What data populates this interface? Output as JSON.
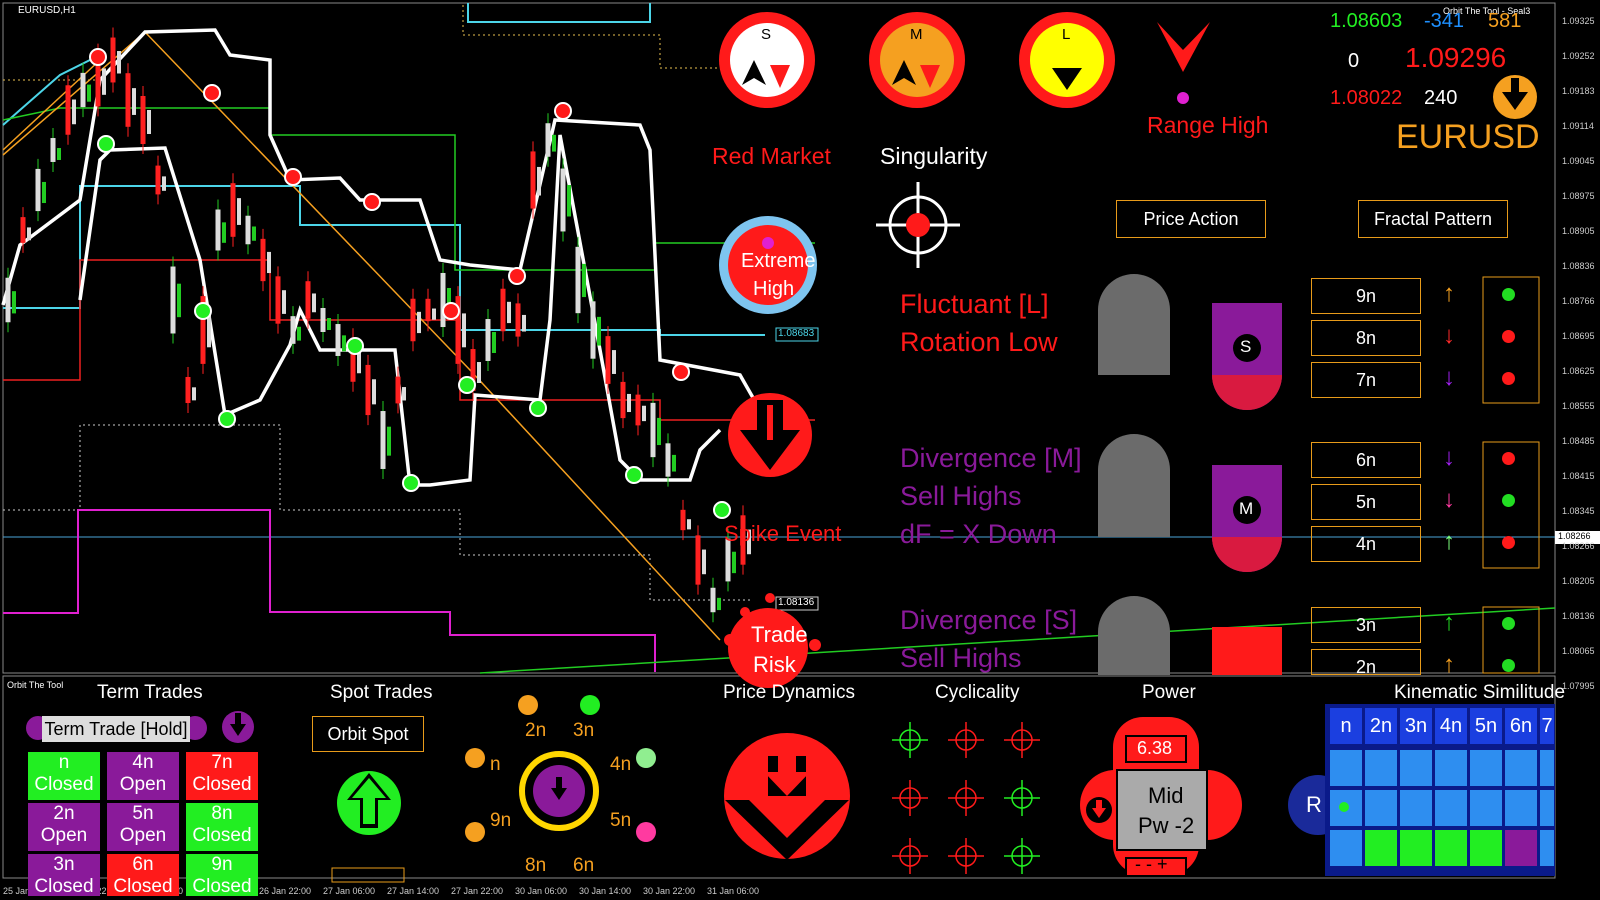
{
  "window": {
    "symbol_tf": "EURUSD,H1",
    "indicator_name": "Orbit The Tool - Seal3",
    "subwindow_name": "Orbit The Tool"
  },
  "price_axis": [
    "1.09325",
    "1.09252",
    "1.09183",
    "1.09114",
    "1.09045",
    "1.08975",
    "1.08905",
    "1.08836",
    "1.08766",
    "1.08695",
    "1.08625",
    "1.08555",
    "1.08485",
    "1.08415",
    "1.08345",
    "1.08266",
    "1.08205",
    "1.08136",
    "1.08065",
    "1.07995"
  ],
  "time_axis": [
    "25 Jan 2023",
    "25 Jan 22:00",
    "26 Jan 06:00",
    "26 Jan 14:00",
    "26 Jan 22:00",
    "27 Jan 06:00",
    "27 Jan 14:00",
    "27 Jan 22:00",
    "30 Jan 06:00",
    "30 Jan 14:00",
    "30 Jan 22:00",
    "31 Jan 06:00"
  ],
  "chart_tags": {
    "tag1": "1.08683",
    "tag2": "1.08136",
    "tag3": "1.08266"
  },
  "quote": {
    "bid": "1.08603",
    "change": "-341",
    "spread": "581",
    "zero": "0",
    "high": "1.09296",
    "low": "1.08022",
    "range": "240",
    "symbol": "EURUSD"
  },
  "seals": {
    "s": "S",
    "m": "M",
    "l": "L"
  },
  "labels": {
    "red_market": "Red Market",
    "singularity": "Singularity",
    "range_high": "Range High",
    "extreme_high_1": "Extreme",
    "extreme_high_2": "High",
    "spike_event": "Spike Event",
    "trade_risk_1": "Trade",
    "trade_risk_2": "Risk",
    "fluctuant": "Fluctuant [L]",
    "rotation_low": "Rotation Low",
    "div_m": "Divergence [M]",
    "sell_highs_m": "Sell Highs",
    "df_down": "dF = X Down",
    "div_s": "Divergence [S]",
    "sell_highs_s": "Sell Highs"
  },
  "buttons": {
    "price_action": "Price Action",
    "fractal_pattern": "Fractal Pattern",
    "orbit_spot": "Orbit Spot",
    "term_trade": "Term Trade [Hold]",
    "partial_btn": "R"
  },
  "dial_letters": {
    "l": "S",
    "m": "M",
    "s": "S"
  },
  "fractals": [
    "9n",
    "8n",
    "7n",
    "6n",
    "5n",
    "4n",
    "3n",
    "2n"
  ],
  "fractal_arrows": [
    "↑",
    "↓",
    "↓",
    "↓",
    "↓",
    "↑",
    "↑",
    "↑"
  ],
  "fractal_arrow_colors": [
    "#f5a020",
    "#ff2a2a",
    "#a020f0",
    "#a020f0",
    "#ff3aa0",
    "#7dff7d",
    "#22dd22",
    "#f5a020"
  ],
  "fractal_dots": [
    "#22dd22",
    "#ff1a1a",
    "#ff1a1a",
    "#ff1a1a",
    "#22dd22",
    "#ff1a1a",
    "#22dd22",
    "#22dd22"
  ],
  "panels": {
    "term_trades": "Term Trades",
    "spot_trades": "Spot Trades",
    "price_dynamics": "Price Dynamics",
    "cyclicality": "Cyclicality",
    "power": "Power",
    "kinematic": "Kinematic Similitude"
  },
  "term_cells": [
    {
      "n": "n",
      "state": "Closed",
      "color": "#22ee22"
    },
    {
      "n": "4n",
      "state": "Open",
      "color": "#8a1a9a"
    },
    {
      "n": "7n",
      "state": "Closed",
      "color": "#ff1a1a"
    },
    {
      "n": "2n",
      "state": "Open",
      "color": "#8a1a9a"
    },
    {
      "n": "5n",
      "state": "Open",
      "color": "#8a1a9a"
    },
    {
      "n": "8n",
      "state": "Closed",
      "color": "#22ee22"
    },
    {
      "n": "3n",
      "state": "Closed",
      "color": "#8a1a9a"
    },
    {
      "n": "6n",
      "state": "Closed",
      "color": "#ff1a1a"
    },
    {
      "n": "9n",
      "state": "Closed",
      "color": "#22ee22"
    }
  ],
  "orbit_labels": {
    "n2": "2n",
    "n3": "3n",
    "n": "n",
    "n4": "4n",
    "n9": "9n",
    "n5": "5n",
    "n8": "8n",
    "n6": "6n"
  },
  "power": {
    "value": "6.38",
    "state": "Mid",
    "pw": "Pw -2"
  },
  "kinematic_headers": [
    "n",
    "2n",
    "3n",
    "4n",
    "5n",
    "6n",
    "7"
  ],
  "kinematic_rows": [
    [
      "#2e8ef0",
      "#2e8ef0",
      "#2e8ef0",
      "#2e8ef0",
      "#2e8ef0",
      "#2e8ef0",
      "#2e8ef0"
    ],
    [
      "#2e8ef0",
      "#2e8ef0",
      "#2e8ef0",
      "#2e8ef0",
      "#2e8ef0",
      "#2e8ef0",
      "#2e8ef0"
    ],
    [
      "#2e8ef0",
      "#22ee22",
      "#22ee22",
      "#22ee22",
      "#22ee22",
      "#8a1a9a",
      "#2e8ef0"
    ]
  ]
}
